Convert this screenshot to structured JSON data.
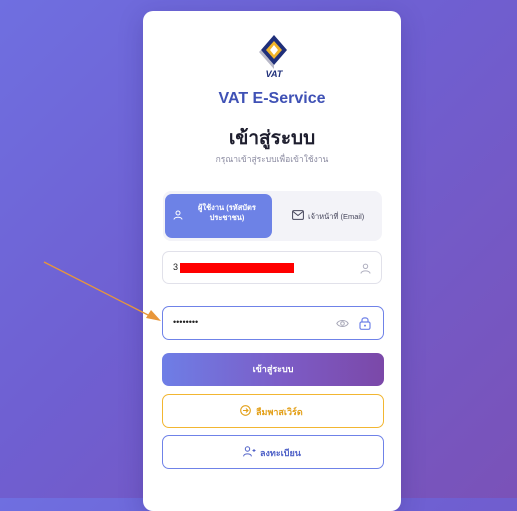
{
  "brand": {
    "logo_text": "VAT",
    "name": "VAT E-Service"
  },
  "login": {
    "title": "เข้าสู่ระบบ",
    "subtitle": "กรุณาเข้าสู่ระบบเพื่อเข้าใช้งาน"
  },
  "tabs": [
    {
      "label_line1": "ผู้ใช้งาน (รหัสบัตร",
      "label_line2": "ประชาชน)",
      "icon": "user-icon",
      "active": true
    },
    {
      "label": "เจ้าหน้าที่ (Email)",
      "icon": "mail-icon",
      "active": false
    }
  ],
  "fields": {
    "username_value": "3",
    "password_value": "••••••••"
  },
  "buttons": {
    "login": "เข้าสู่ระบบ",
    "forgot": "ลืมพาสเวิร์ด",
    "register": "ลงทะเบียน"
  },
  "colors": {
    "accent": "#6d82e6",
    "forgot": "#f2b631",
    "redaction": "#ff0000",
    "annotation_arrow": "#e8963a"
  }
}
